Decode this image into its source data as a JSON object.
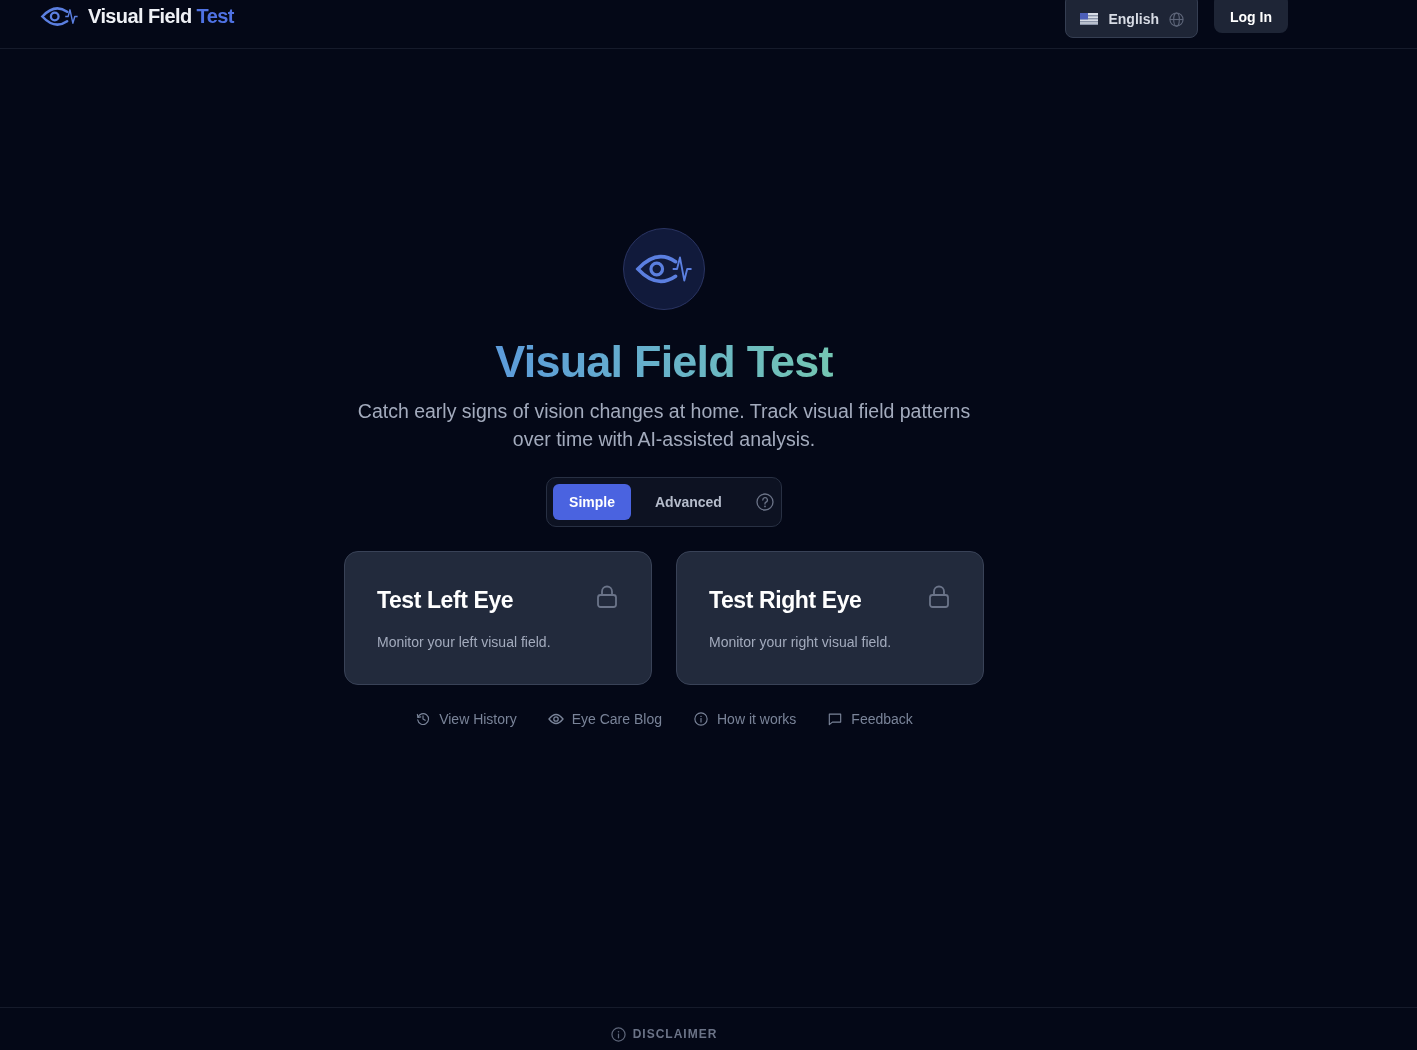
{
  "header": {
    "brand": {
      "name": "Visual Field",
      "accent": "Test"
    },
    "language": {
      "label": "English"
    },
    "login": {
      "label": "Log In"
    }
  },
  "hero": {
    "title": "Visual Field Test",
    "subtitle": "Catch early signs of vision changes at home. Track visual field patterns over time with AI-assisted analysis."
  },
  "modes": [
    {
      "label": "Simple",
      "selected": true
    },
    {
      "label": "Advanced",
      "selected": false
    }
  ],
  "cards": [
    {
      "title": "Test Left Eye",
      "description": "Monitor your left visual field.",
      "locked": true
    },
    {
      "title": "Test Right Eye",
      "description": "Monitor your right visual field.",
      "locked": true
    }
  ],
  "links": [
    {
      "kind": "history",
      "label": "View History"
    },
    {
      "kind": "eye",
      "label": "Eye Care Blog"
    },
    {
      "kind": "info",
      "label": "How it works"
    },
    {
      "kind": "chat",
      "label": "Feedback"
    }
  ],
  "footer": {
    "disclaimer": "DISCLAIMER"
  }
}
